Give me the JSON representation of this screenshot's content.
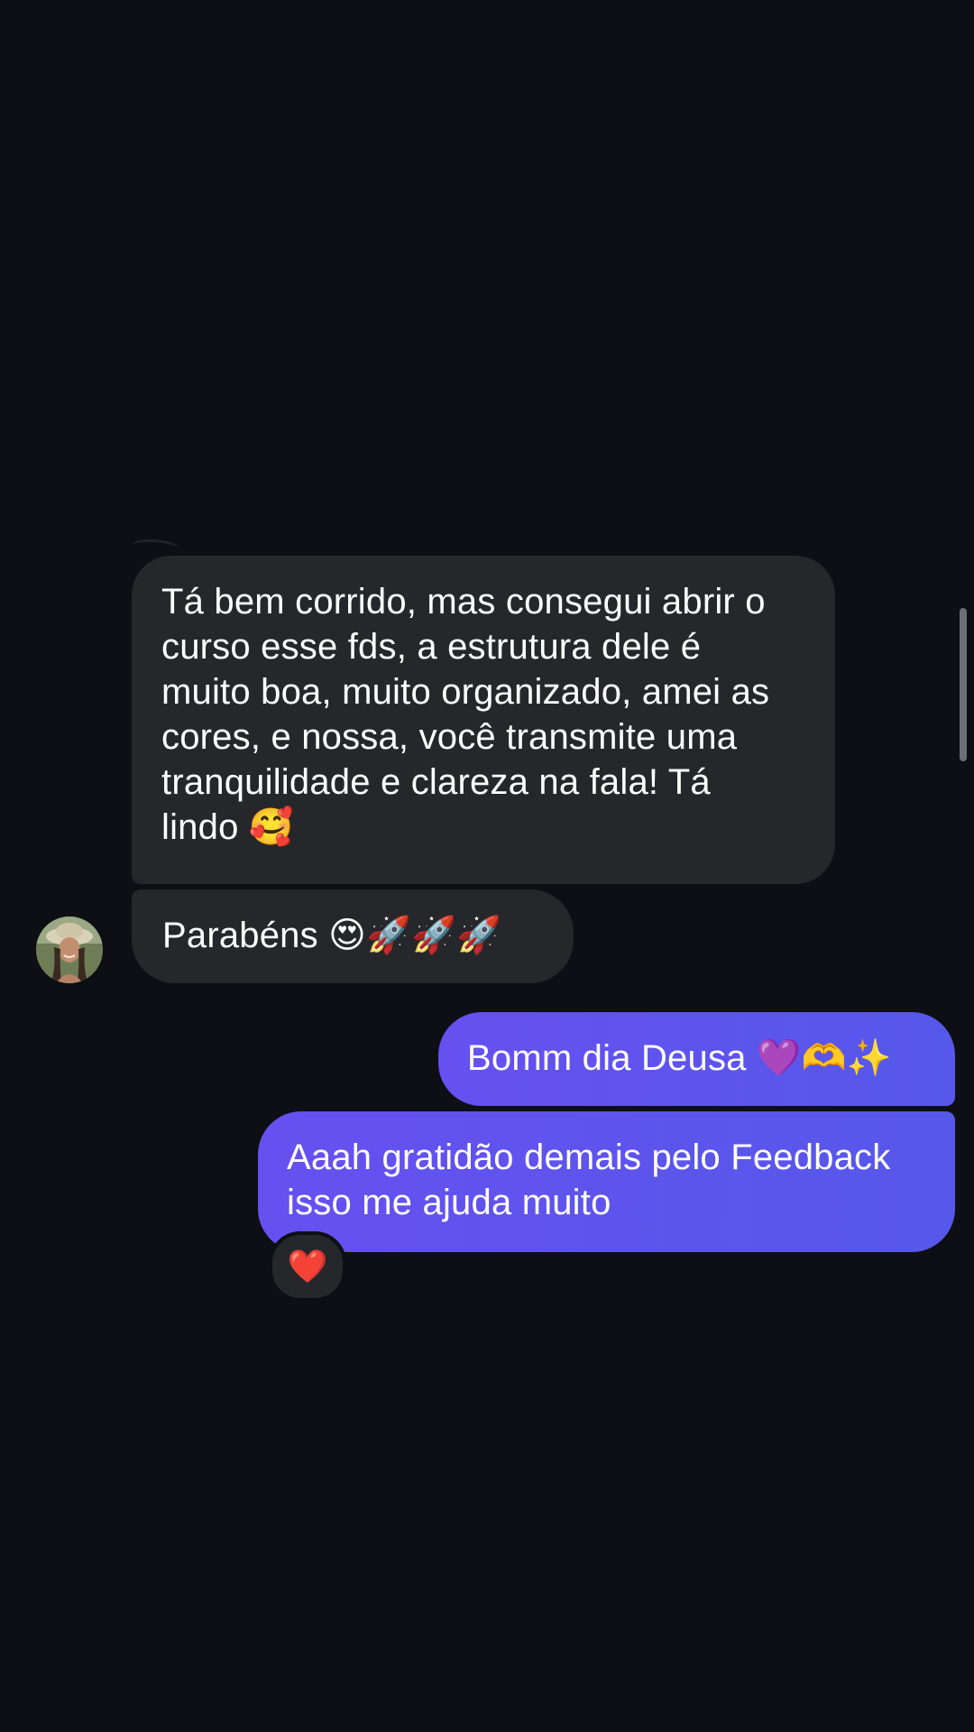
{
  "conversation": {
    "messages": [
      {
        "direction": "received",
        "text": "Tá bem corrido, mas consegui abrir o\ncurso esse fds, a estrutura dele é\nmuito boa, muito organizado, amei as\ncores, e nossa, você transmite uma\ntranquilidade e clareza na fala! Tá\nlindo 🥰"
      },
      {
        "direction": "received",
        "text": "Parabéns 😍🚀🚀🚀"
      },
      {
        "direction": "sent",
        "text": "Bomm dia Deusa 💜🫶✨"
      },
      {
        "direction": "sent",
        "text": "Aaah gratidão demais pelo Feedback\nisso me ajuda muito",
        "reaction": "❤️"
      }
    ]
  },
  "colors": {
    "background": "#0d0f14",
    "received_bubble": "#26272b",
    "sent_bubble": "#5f55ee",
    "reaction_heart": "#ff2d3d"
  },
  "icons": {
    "avatar": "contact-avatar",
    "reaction": "heart-reaction-icon"
  }
}
